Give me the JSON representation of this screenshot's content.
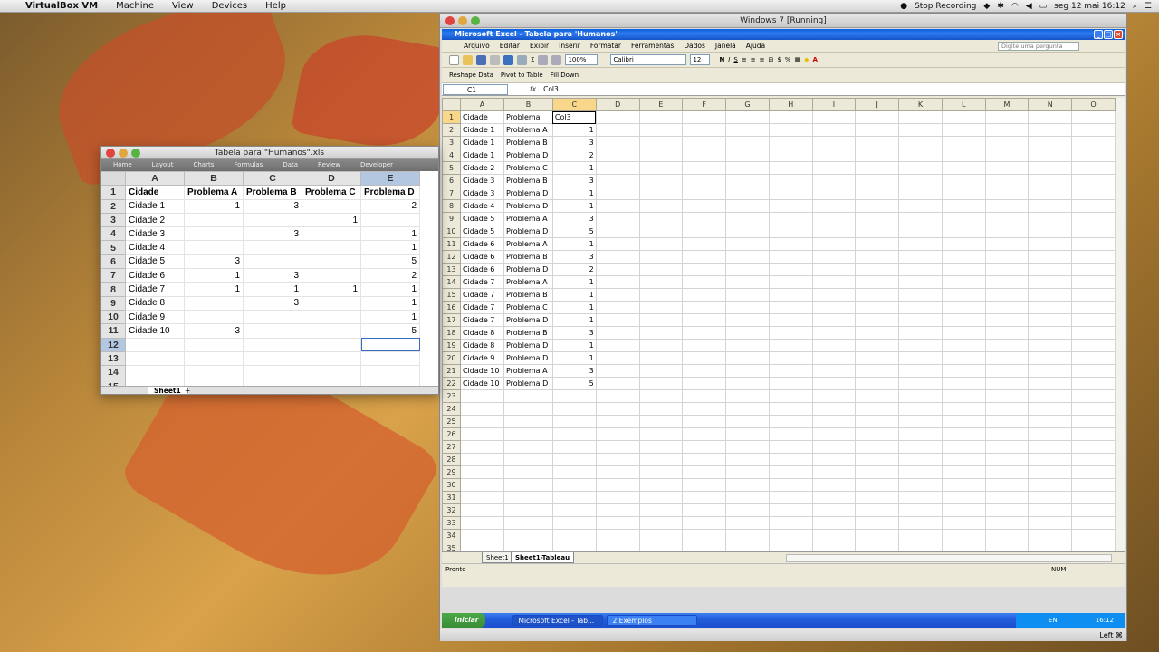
{
  "mac_menubar": {
    "app_name": "VirtualBox VM",
    "menus": [
      "Machine",
      "View",
      "Devices",
      "Help"
    ],
    "recording": "Stop Recording",
    "clock": "seg 12 mai  16:12"
  },
  "vbox": {
    "title": "Windows 7 [Running]",
    "status_right": "Left ⌘"
  },
  "excel_win": {
    "title": "Microsoft Excel - Tabela para 'Humanos'",
    "menus": [
      "Arquivo",
      "Editar",
      "Exibir",
      "Inserir",
      "Formatar",
      "Ferramentas",
      "Dados",
      "Janela",
      "Ajuda"
    ],
    "ask_placeholder": "Digite uma pergunta",
    "zoom": "100%",
    "font": "Calibri",
    "font_size": "12",
    "toolbar2": [
      "Reshape Data",
      "Pivot to Table",
      "Fill Down"
    ],
    "name_box": "C1",
    "fx": "fx",
    "formula": "Col3",
    "columns": [
      "A",
      "B",
      "C",
      "D",
      "E",
      "F",
      "G",
      "H",
      "I",
      "J",
      "K",
      "L",
      "M",
      "N",
      "O"
    ],
    "rows": [
      [
        "Cidade",
        "Problema",
        "Col3"
      ],
      [
        "Cidade 1",
        "Problema A",
        "1"
      ],
      [
        "Cidade 1",
        "Problema B",
        "3"
      ],
      [
        "Cidade 1",
        "Problema D",
        "2"
      ],
      [
        "Cidade 2",
        "Problema C",
        "1"
      ],
      [
        "Cidade 3",
        "Problema B",
        "3"
      ],
      [
        "Cidade 3",
        "Problema D",
        "1"
      ],
      [
        "Cidade 4",
        "Problema D",
        "1"
      ],
      [
        "Cidade 5",
        "Problema A",
        "3"
      ],
      [
        "Cidade 5",
        "Problema D",
        "5"
      ],
      [
        "Cidade 6",
        "Problema A",
        "1"
      ],
      [
        "Cidade 6",
        "Problema B",
        "3"
      ],
      [
        "Cidade 6",
        "Problema D",
        "2"
      ],
      [
        "Cidade 7",
        "Problema A",
        "1"
      ],
      [
        "Cidade 7",
        "Problema B",
        "1"
      ],
      [
        "Cidade 7",
        "Problema C",
        "1"
      ],
      [
        "Cidade 7",
        "Problema D",
        "1"
      ],
      [
        "Cidade 8",
        "Problema B",
        "3"
      ],
      [
        "Cidade 8",
        "Problema D",
        "1"
      ],
      [
        "Cidade 9",
        "Problema D",
        "1"
      ],
      [
        "Cidade 10",
        "Problema A",
        "3"
      ],
      [
        "Cidade 10",
        "Problema D",
        "5"
      ]
    ],
    "total_rows": 36,
    "sheet_tabs": [
      "Sheet1",
      "Sheet1-Tableau"
    ],
    "active_tab": "Sheet1-Tableau",
    "status": "Pronto",
    "status_num": "NUM"
  },
  "taskbar": {
    "start": "Iniciar",
    "tasks": [
      "Microsoft Excel - Tab...",
      "2 Exemplos"
    ],
    "lang": "EN",
    "time": "16:12"
  },
  "mac_excel": {
    "title": "Tabela para \"Humanos\".xls",
    "ribbon": [
      "Home",
      "Layout",
      "Charts",
      "Formulas",
      "Data",
      "Review",
      "Developer"
    ],
    "columns": [
      "A",
      "B",
      "C",
      "D",
      "E"
    ],
    "header": [
      "Cidade",
      "Problema A",
      "Problema B",
      "Problema C",
      "Problema D"
    ],
    "rows": [
      [
        "Cidade 1",
        "1",
        "3",
        "",
        "2"
      ],
      [
        "Cidade 2",
        "",
        "",
        "1",
        ""
      ],
      [
        "Cidade 3",
        "",
        "3",
        "",
        "1"
      ],
      [
        "Cidade 4",
        "",
        "",
        "",
        "1"
      ],
      [
        "Cidade 5",
        "3",
        "",
        "",
        "5"
      ],
      [
        "Cidade 6",
        "1",
        "3",
        "",
        "2"
      ],
      [
        "Cidade 7",
        "1",
        "1",
        "1",
        "1"
      ],
      [
        "Cidade 8",
        "",
        "3",
        "",
        "1"
      ],
      [
        "Cidade 9",
        "",
        "",
        "",
        "1"
      ],
      [
        "Cidade 10",
        "3",
        "",
        "",
        "5"
      ]
    ],
    "total_rows": 15,
    "sheet_tab": "Sheet1",
    "add_tab": "+"
  }
}
